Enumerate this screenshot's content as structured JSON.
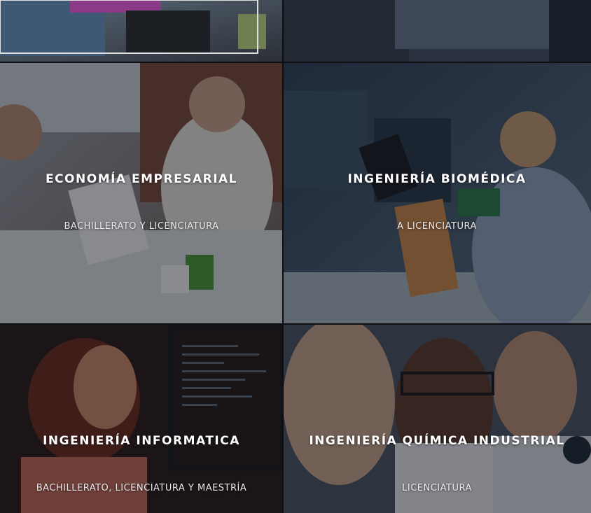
{
  "programs": [
    {
      "title": "ECONOMÍA EMPRESARIAL",
      "subtitle": "BACHILLERATO Y LICENCIATURA"
    },
    {
      "title": "INGENIERÍA BIOMÉDICA",
      "subtitle": "A LICENCIATURA"
    },
    {
      "title": "INGENIERÍA INFORMATICA",
      "subtitle": "BACHILLERATO, LICENCIATURA Y MAESTRÍA"
    },
    {
      "title": "INGENIERÍA QUÍMICA INDUSTRIAL",
      "subtitle": "LICENCIATURA"
    }
  ],
  "colors": {
    "overlay": "#0a0e16",
    "title_text": "#ffffff",
    "subtitle_text": "#e8e8e8"
  }
}
